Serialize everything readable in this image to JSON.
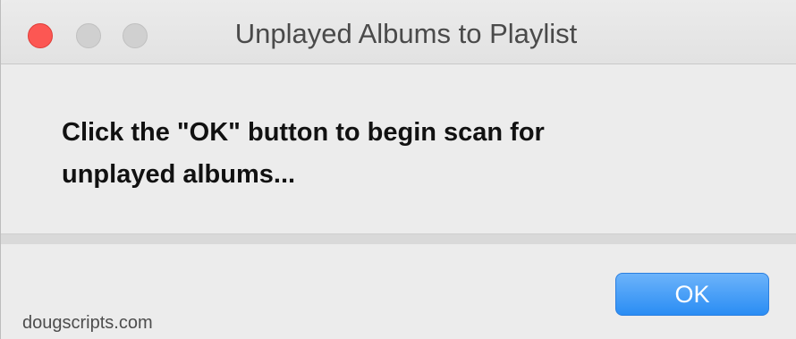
{
  "window": {
    "title": "Unplayed Albums to Playlist"
  },
  "dialog": {
    "message_line1": "Click the \"OK\" button to begin scan for",
    "message_line2": "unplayed albums...",
    "ok_label": "OK"
  },
  "footer": {
    "credit": "dougscripts.com"
  },
  "colors": {
    "accent": "#2a8df4",
    "close": "#fc5753"
  }
}
